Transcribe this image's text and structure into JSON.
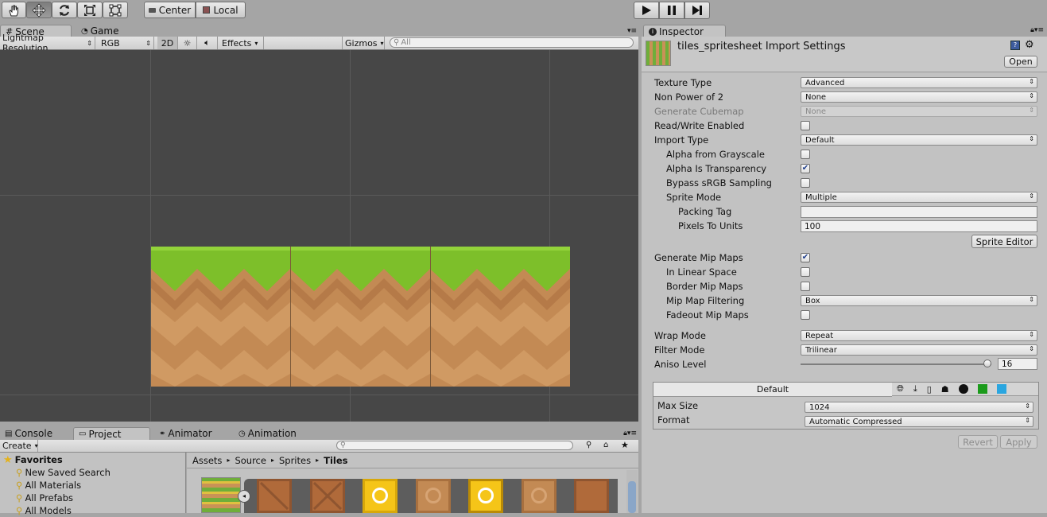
{
  "toolbar": {
    "pivot_label": "Center",
    "space_label": "Local"
  },
  "scene_tabs": {
    "scene": "Scene",
    "game": "Game"
  },
  "scene_toolbar": {
    "render_mode": "Lightmap Resolution",
    "color_mode": "RGB",
    "mode_2d": "2D",
    "effects": "Effects",
    "gizmos": "Gizmos",
    "search_placeholder": "All"
  },
  "inspector": {
    "tab": "Inspector",
    "title": "tiles_spritesheet Import Settings",
    "open_button": "Open",
    "properties": {
      "texture_type": {
        "label": "Texture Type",
        "value": "Advanced"
      },
      "non_power_of_2": {
        "label": "Non Power of 2",
        "value": "None"
      },
      "generate_cubemap": {
        "label": "Generate Cubemap",
        "value": "None"
      },
      "read_write": {
        "label": "Read/Write Enabled",
        "checked": false
      },
      "import_type": {
        "label": "Import Type",
        "value": "Default"
      },
      "alpha_from_grayscale": {
        "label": "Alpha from Grayscale",
        "checked": false
      },
      "alpha_is_transparency": {
        "label": "Alpha Is Transparency",
        "checked": true
      },
      "bypass_srgb": {
        "label": "Bypass sRGB Sampling",
        "checked": false
      },
      "sprite_mode": {
        "label": "Sprite Mode",
        "value": "Multiple"
      },
      "packing_tag": {
        "label": "Packing Tag",
        "value": ""
      },
      "pixels_to_units": {
        "label": "Pixels To Units",
        "value": "100"
      },
      "generate_mip_maps": {
        "label": "Generate Mip Maps",
        "checked": true
      },
      "in_linear_space": {
        "label": "In Linear Space",
        "checked": false
      },
      "border_mip_maps": {
        "label": "Border Mip Maps",
        "checked": false
      },
      "mip_map_filtering": {
        "label": "Mip Map Filtering",
        "value": "Box"
      },
      "fadeout_mip_maps": {
        "label": "Fadeout Mip Maps",
        "checked": false
      },
      "wrap_mode": {
        "label": "Wrap Mode",
        "value": "Repeat"
      },
      "filter_mode": {
        "label": "Filter Mode",
        "value": "Trilinear"
      },
      "aniso_level": {
        "label": "Aniso Level",
        "value": "16",
        "slider_fraction": 0.98
      }
    },
    "sprite_editor_button": "Sprite Editor",
    "platform": {
      "default_tab": "Default",
      "max_size": {
        "label": "Max Size",
        "value": "1024"
      },
      "format": {
        "label": "Format",
        "value": "Automatic Compressed"
      }
    },
    "revert_button": "Revert",
    "apply_button": "Apply"
  },
  "bottom_tabs": {
    "console": "Console",
    "project": "Project",
    "animator": "Animator",
    "animation": "Animation"
  },
  "project": {
    "create": "Create",
    "favorites_title": "Favorites",
    "favorites": [
      "New Saved Search",
      "All Materials",
      "All Prefabs",
      "All Models"
    ],
    "breadcrumb": [
      "Assets",
      "Source",
      "Sprites",
      "Tiles"
    ]
  },
  "colors": {
    "grass": "#7dbf2a",
    "dirt": "#c38a54",
    "scene_bg": "#474747",
    "panel_bg": "#c2c2c2"
  }
}
